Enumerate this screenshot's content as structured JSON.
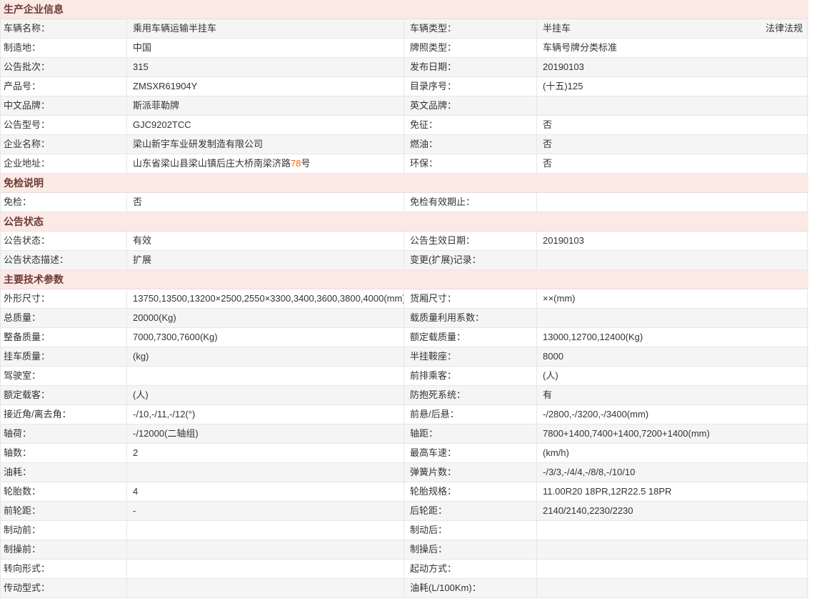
{
  "page_title": "车辆公告信息",
  "theme": {
    "section_bg": "#fbe9e5",
    "section_text": "#6d3a34",
    "row_alt_bg": "#f5f5f5",
    "border": "#e4e7ea",
    "text": "#333333",
    "highlight": "#ff6600",
    "link_text": "#333333"
  },
  "sections": [
    {
      "title": "生产企业信息",
      "stripe_offset": 0,
      "rows": [
        {
          "left": {
            "label": "车辆名称：",
            "value": "乘用车辆运输半挂车"
          },
          "right": {
            "label": "车辆类型：",
            "value": "半挂车",
            "link": "法律法规"
          }
        },
        {
          "left": {
            "label": "制造地：",
            "value": "中国"
          },
          "right": {
            "label": "牌照类型：",
            "value": "车辆号牌分类标准"
          }
        },
        {
          "left": {
            "label": "公告批次：",
            "value": "315"
          },
          "right": {
            "label": "发布日期：",
            "value": "20190103"
          }
        },
        {
          "left": {
            "label": "产品号：",
            "value": "ZMSXR61904Y"
          },
          "right": {
            "label": "目录序号：",
            "value": "(十五)125"
          }
        },
        {
          "left": {
            "label": "中文品牌：",
            "value": "斯派菲勒牌"
          },
          "right": {
            "label": "英文品牌：",
            "value": ""
          }
        },
        {
          "left": {
            "label": "公告型号：",
            "value": "GJC9202TCC"
          },
          "right": {
            "label": "免征：",
            "value": "否"
          }
        },
        {
          "left": {
            "label": "企业名称：",
            "value": "梁山新宇车业研发制造有限公司"
          },
          "right": {
            "label": "燃油：",
            "value": "否"
          }
        },
        {
          "left": {
            "label": "企业地址：",
            "value_parts": [
              {
                "t": "山东省梁山县梁山镇后庄大桥南梁济路"
              },
              {
                "t": "78",
                "hl": true
              },
              {
                "t": "号"
              }
            ]
          },
          "right": {
            "label": "环保：",
            "value": "否"
          }
        }
      ]
    },
    {
      "title": "免检说明",
      "stripe_offset": 1,
      "rows": [
        {
          "left": {
            "label": "免检：",
            "value": "否"
          },
          "right": {
            "label": "免检有效期止：",
            "value": ""
          }
        }
      ]
    },
    {
      "title": "公告状态",
      "stripe_offset": 1,
      "rows": [
        {
          "left": {
            "label": "公告状态：",
            "value": "有效"
          },
          "right": {
            "label": "公告生效日期：",
            "value": "20190103"
          }
        },
        {
          "left": {
            "label": "公告状态描述：",
            "value": "扩展"
          },
          "right": {
            "label": "变更(扩展)记录：",
            "value": ""
          }
        }
      ]
    },
    {
      "title": "主要技术参数",
      "stripe_offset": 1,
      "rows": [
        {
          "left": {
            "label": "外形尺寸：",
            "value": "13750,13500,13200×2500,2550×3300,3400,3600,3800,4000(mm)"
          },
          "right": {
            "label": "货厢尺寸：",
            "value": "××(mm)"
          }
        },
        {
          "left": {
            "label": "总质量：",
            "value": "20000(Kg)"
          },
          "right": {
            "label": "载质量利用系数：",
            "value": ""
          }
        },
        {
          "left": {
            "label": "整备质量：",
            "value": "7000,7300,7600(Kg)"
          },
          "right": {
            "label": "额定载质量：",
            "value": "13000,12700,12400(Kg)"
          }
        },
        {
          "left": {
            "label": "挂车质量：",
            "value": "(kg)"
          },
          "right": {
            "label": "半挂鞍座：",
            "value": "8000"
          }
        },
        {
          "left": {
            "label": "驾驶室：",
            "value": ""
          },
          "right": {
            "label": "前排乘客：",
            "value": "(人)"
          }
        },
        {
          "left": {
            "label": "额定载客：",
            "value": "(人)"
          },
          "right": {
            "label": "防抱死系统：",
            "value": "有"
          }
        },
        {
          "left": {
            "label": "接近角/离去角：",
            "value": "-/10,-/11,-/12(°)"
          },
          "right": {
            "label": "前悬/后悬：",
            "value": "-/2800,-/3200,-/3400(mm)"
          }
        },
        {
          "left": {
            "label": "轴荷：",
            "value": "-/12000(二轴组)"
          },
          "right": {
            "label": "轴距：",
            "value": "7800+1400,7400+1400,7200+1400(mm)"
          }
        },
        {
          "left": {
            "label": "轴数：",
            "value": "2"
          },
          "right": {
            "label": "最高车速：",
            "value": "(km/h)"
          }
        },
        {
          "left": {
            "label": "油耗：",
            "value": ""
          },
          "right": {
            "label": "弹簧片数：",
            "value": "-/3/3,-/4/4,-/8/8,-/10/10"
          }
        },
        {
          "left": {
            "label": "轮胎数：",
            "value": "4"
          },
          "right": {
            "label": "轮胎规格：",
            "value": "11.00R20 18PR,12R22.5 18PR"
          }
        },
        {
          "left": {
            "label": "前轮距：",
            "value": "-"
          },
          "right": {
            "label": "后轮距：",
            "value": "2140/2140,2230/2230"
          }
        },
        {
          "left": {
            "label": "制动前：",
            "value": ""
          },
          "right": {
            "label": "制动后：",
            "value": ""
          }
        },
        {
          "left": {
            "label": "制操前：",
            "value": ""
          },
          "right": {
            "label": "制操后：",
            "value": ""
          }
        },
        {
          "left": {
            "label": "转向形式：",
            "value": ""
          },
          "right": {
            "label": "起动方式：",
            "value": ""
          }
        },
        {
          "left": {
            "label": "传动型式：",
            "value": ""
          },
          "right": {
            "label": "油耗(L/100Km)：",
            "value": ""
          }
        }
      ]
    }
  ]
}
